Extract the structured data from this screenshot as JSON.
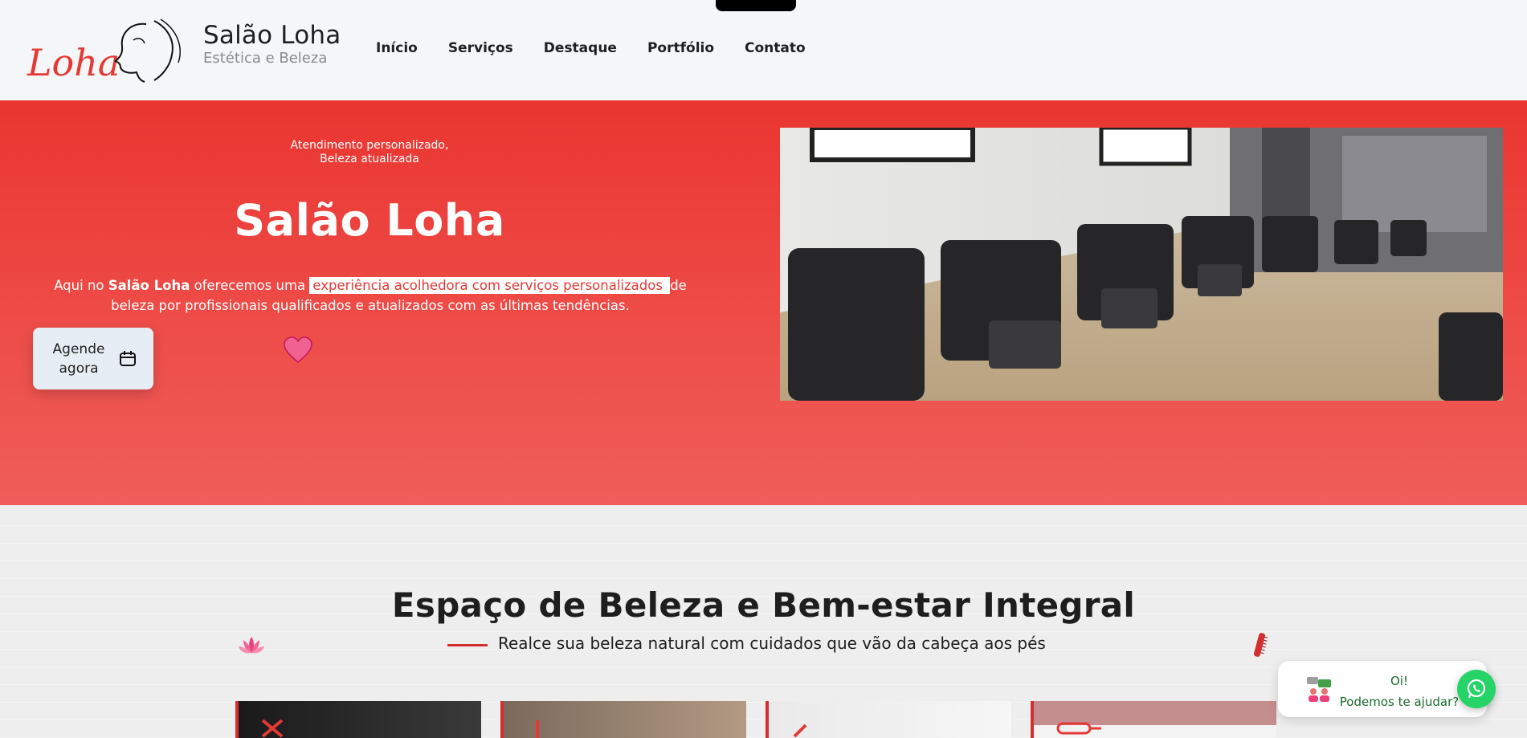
{
  "header": {
    "brand_name": "Salão Loha",
    "brand_subtitle": "Estética e Beleza",
    "logo_text": "Loha",
    "nav": [
      "Início",
      "Serviços",
      "Destaque",
      "Portfólio",
      "Contato"
    ]
  },
  "hero": {
    "tagline_line1": "Atendimento personalizado,",
    "tagline_line2": "Beleza atualizada",
    "title": "Salão Loha",
    "text_pre": "Aqui no ",
    "text_brand": "Salão Loha",
    "text_mid": " oferecemos uma ",
    "text_highlight": "experiência acolhedora com serviços personalizados ",
    "text_post": " de beleza por profissionais qualificados e atualizados com as últimas tendências.",
    "cta_label": "Agende agora",
    "cta_icon": "calendar-icon",
    "photo": "salon-pedicure-chairs-photo"
  },
  "section": {
    "title": "Espaço de Beleza e Bem-estar Integral",
    "subtitle": "Realce sua beleza natural com cuidados que vão da cabeça aos pés"
  },
  "chat": {
    "line1": "Oi!",
    "line2": "Podemos te ajudar?",
    "icon": "whatsapp-icon"
  },
  "colors": {
    "accent": "#e53935",
    "hero_top": "#ea3530",
    "whatsapp": "#25d366"
  }
}
